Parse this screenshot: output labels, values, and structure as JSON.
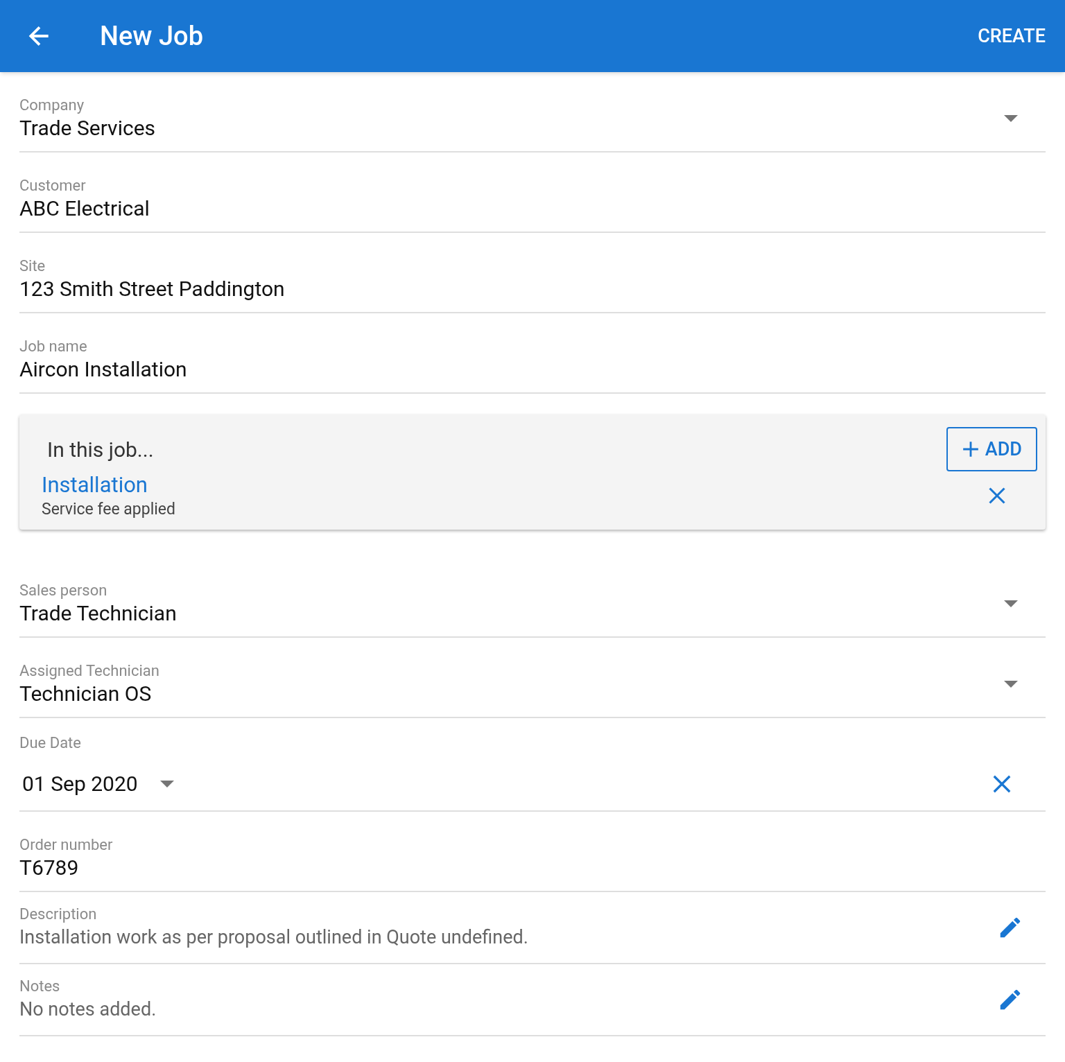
{
  "app_bar": {
    "title": "New Job",
    "action": "CREATE"
  },
  "fields_top": [
    {
      "kind": "dropdown",
      "label": "Company",
      "value": "Trade Services"
    },
    {
      "kind": "text",
      "label": "Customer",
      "value": "ABC Electrical"
    },
    {
      "kind": "text",
      "label": "Site",
      "value": "123 Smith Street Paddington"
    },
    {
      "kind": "text",
      "label": "Job name",
      "value": "Aircon Installation"
    }
  ],
  "job_items_card": {
    "title": "In this job...",
    "add_button": "ADD",
    "items": [
      {
        "name": "Installation",
        "subtitle": "Service fee applied"
      }
    ]
  },
  "fields_bottom": [
    {
      "kind": "dropdown",
      "label": "Sales person",
      "value": "Trade Technician"
    },
    {
      "kind": "dropdown",
      "label": "Assigned Technician",
      "value": "Technician OS"
    },
    {
      "kind": "date",
      "label": "Due Date",
      "value": "01 Sep 2020"
    },
    {
      "kind": "text",
      "label": "Order number",
      "value": "T6789"
    },
    {
      "kind": "editable",
      "label": "Description",
      "value": "Installation work as per proposal outlined in Quote undefined."
    },
    {
      "kind": "editable",
      "label": "Notes",
      "value": "No notes added."
    }
  ]
}
